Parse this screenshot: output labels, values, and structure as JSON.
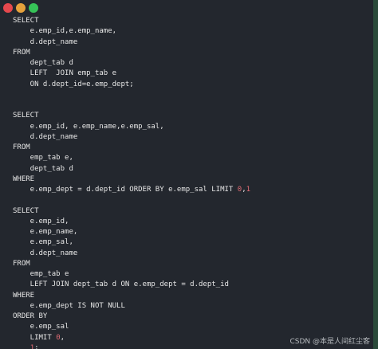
{
  "window": {
    "controls": [
      {
        "name": "close",
        "color": "#e5484d"
      },
      {
        "name": "minimize",
        "color": "#e6a23c"
      },
      {
        "name": "zoom",
        "color": "#36c257"
      }
    ]
  },
  "code_lines": [
    "SELECT",
    "    e.emp_id,e.emp_name,",
    "    d.dept_name",
    "FROM",
    "    dept_tab d",
    "    LEFT  JOIN emp_tab e",
    "    ON d.dept_id=e.emp_dept;",
    "",
    "",
    "SELECT",
    "    e.emp_id, e.emp_name,e.emp_sal,",
    "    d.dept_name",
    "FROM",
    "    emp_tab e,",
    "    dept_tab d",
    "WHERE",
    "    e.emp_dept = d.dept_id ORDER BY e.emp_sal LIMIT 0,1",
    "",
    "SELECT",
    "    e.emp_id,",
    "    e.emp_name,",
    "    e.emp_sal,",
    "    d.dept_name",
    "FROM",
    "    emp_tab e",
    "    LEFT JOIN dept_tab d ON e.emp_dept = d.dept_id",
    "WHERE",
    "    e.emp_dept IS NOT NULL",
    "ORDER BY",
    "    e.emp_sal",
    "    LIMIT 0,",
    "    1;"
  ],
  "syntax_colors": {
    "background": "#23272e",
    "text": "#e6e6e6",
    "number": "#e06c75"
  },
  "watermark": "CSDN @本是人间红尘客"
}
